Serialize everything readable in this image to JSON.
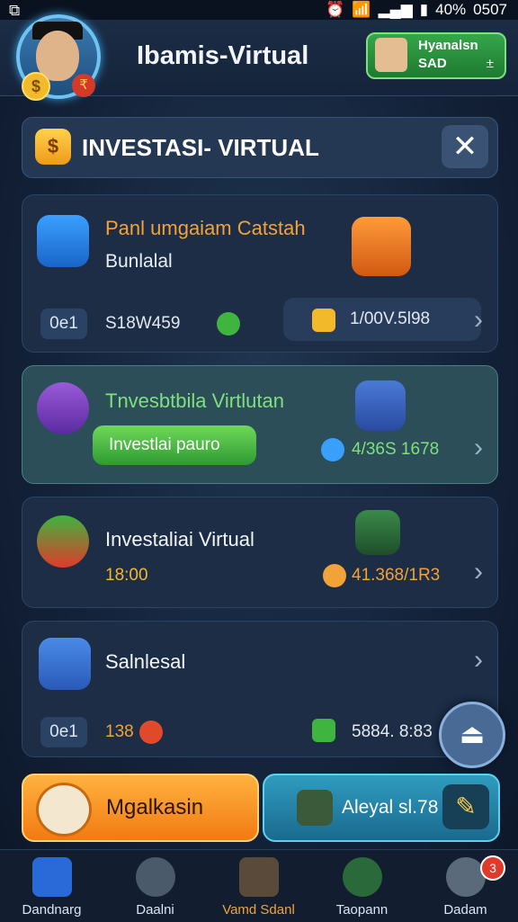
{
  "status_bar": {
    "left_icon": "screenshot-icon",
    "battery_percent": "40%",
    "time": "0507"
  },
  "header": {
    "app_title": "Ibamis-Virtual",
    "profile_name": "Hyanalsn",
    "profile_sub": "SAD",
    "profile_sign": "±"
  },
  "panel": {
    "title": "INVESTASI- VIRTUAL"
  },
  "cards": [
    {
      "title": "Panl umgaiam Catstah",
      "subtitle": "Bunlalal",
      "pill": "0e1",
      "left_value": "S18W459",
      "amount": "1/00V.5l98"
    },
    {
      "title": "Tnvesbtbila Virtlutan",
      "button_label": "Investlai pauro",
      "amount": "4/36S 1678"
    },
    {
      "title": "Investaliai Virtual",
      "time": "18:00",
      "amount": "41.368/1R3"
    },
    {
      "title": "Salnlesal",
      "pill": "0e1",
      "left_value": "138",
      "amount": "5884. 8:83"
    }
  ],
  "actions": {
    "left_label": "Mgalkasin",
    "right_label": "Aleyal sl.78"
  },
  "bottom_nav": [
    {
      "label": "Dandnarg",
      "icon": "home-icon",
      "active": false
    },
    {
      "label": "Daalni",
      "icon": "settings-gear-icon",
      "active": false
    },
    {
      "label": "Vamd Sdanl",
      "icon": "pen-icon",
      "active": true
    },
    {
      "label": "Taopann",
      "icon": "search-icon",
      "active": false
    },
    {
      "label": "Dadam",
      "icon": "profile-icon",
      "active": false,
      "badge": "3"
    }
  ],
  "colors": {
    "accent_orange": "#f2a338",
    "accent_green": "#3fb43f",
    "panel_blue": "#243853"
  }
}
